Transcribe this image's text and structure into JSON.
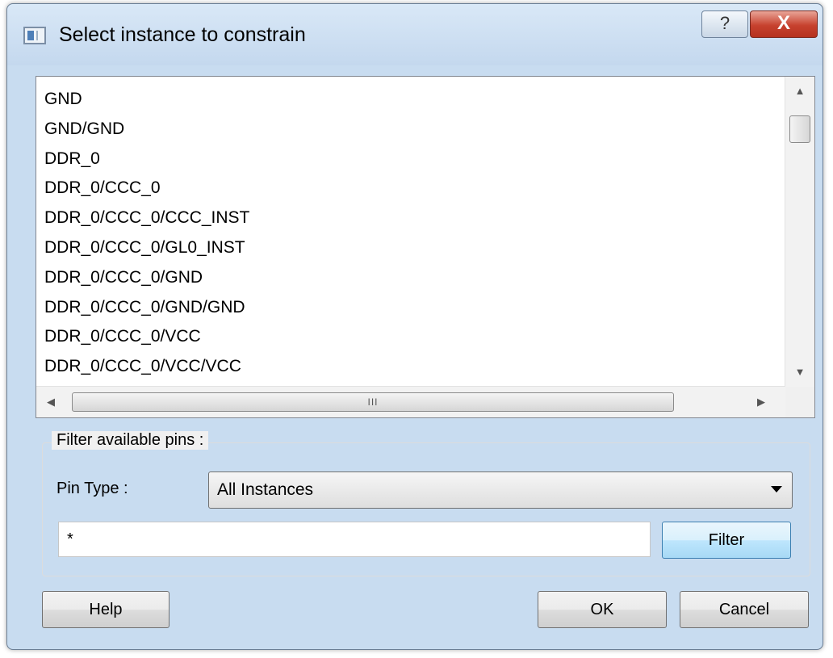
{
  "window": {
    "title": "Select instance to constrain",
    "help_glyph": "?",
    "close_glyph": "X",
    "icon": "app-icon"
  },
  "instance_list": {
    "items": [
      "GND",
      "GND/GND",
      "DDR_0",
      "DDR_0/CCC_0",
      "DDR_0/CCC_0/CCC_INST",
      "DDR_0/CCC_0/GL0_INST",
      "DDR_0/CCC_0/GND",
      "DDR_0/CCC_0/GND/GND",
      "DDR_0/CCC_0/VCC",
      "DDR_0/CCC_0/VCC/VCC"
    ],
    "scroll_up_glyph": "▲",
    "scroll_down_glyph": "▼",
    "scroll_left_glyph": "◀",
    "scroll_right_glyph": "▶",
    "hthumb_grip": "III"
  },
  "filter": {
    "group_label": "Filter available pins :",
    "pin_type_label": "Pin Type :",
    "pin_type_value": "All Instances",
    "filter_value": "*",
    "filter_button": "Filter"
  },
  "buttons": {
    "help": "Help",
    "ok": "OK",
    "cancel": "Cancel"
  }
}
